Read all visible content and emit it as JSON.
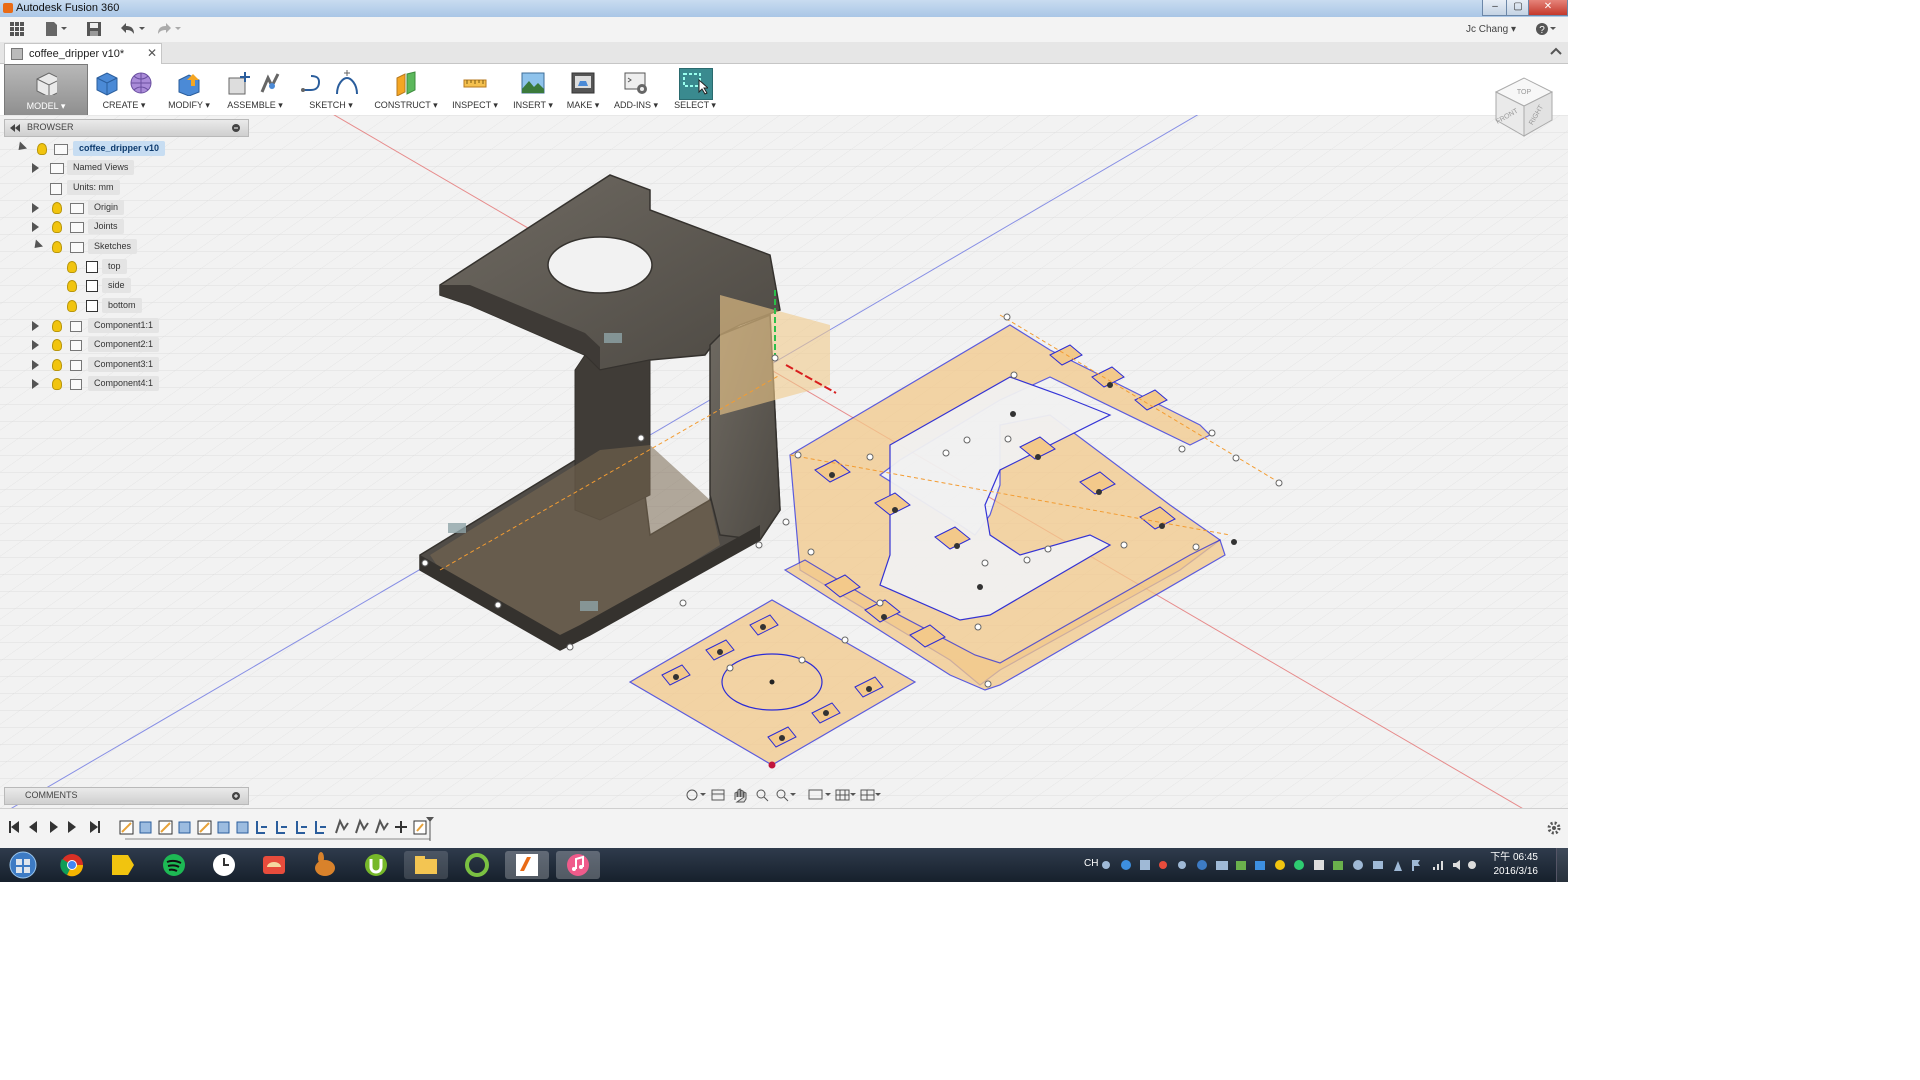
{
  "window": {
    "title": "Autodesk Fusion 360",
    "minimize": "‒",
    "maximize": "▢",
    "close": "✕"
  },
  "qat": {
    "user": "Jc Chang ▾",
    "help": "?"
  },
  "document_tab": {
    "label": "coffee_dripper v10*",
    "close": "✕"
  },
  "ribbon": {
    "groups": [
      {
        "label": "MODEL ▾"
      },
      {
        "label": "CREATE ▾"
      },
      {
        "label": "MODIFY ▾"
      },
      {
        "label": "ASSEMBLE ▾"
      },
      {
        "label": "SKETCH ▾"
      },
      {
        "label": "CONSTRUCT ▾"
      },
      {
        "label": "INSPECT ▾"
      },
      {
        "label": "INSERT ▾"
      },
      {
        "label": "MAKE ▾"
      },
      {
        "label": "ADD-INS ▾"
      },
      {
        "label": "SELECT ▾"
      }
    ]
  },
  "browser": {
    "title": "BROWSER",
    "items": [
      {
        "label": "coffee_dripper v10"
      },
      {
        "label": "Named Views"
      },
      {
        "label": "Units: mm"
      },
      {
        "label": "Origin"
      },
      {
        "label": "Joints"
      },
      {
        "label": "Sketches"
      },
      {
        "label": "top"
      },
      {
        "label": "side"
      },
      {
        "label": "bottom"
      },
      {
        "label": "Component1:1"
      },
      {
        "label": "Component2:1"
      },
      {
        "label": "Component3:1"
      },
      {
        "label": "Component4:1"
      }
    ]
  },
  "comments": {
    "title": "COMMENTS"
  },
  "viewcube": {
    "top": "TOP",
    "front": "FRONT",
    "right": "RIGHT"
  },
  "taskbar": {
    "clock_time": "下午 06:45",
    "clock_date": "2016/3/16",
    "lang": "CH"
  },
  "colors": {
    "accent": "#2e7fd0",
    "sketch_line": "#2b2bd6",
    "profile_fill": "#f3c98a",
    "body": "#5b5650"
  }
}
